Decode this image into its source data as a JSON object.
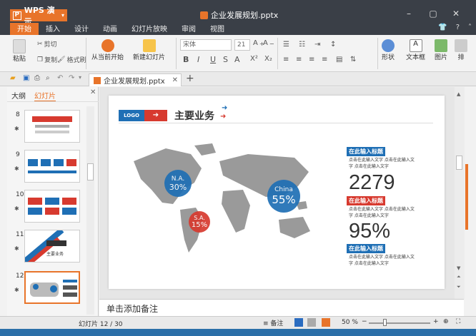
{
  "app": {
    "name": "WPS 演示",
    "doc_title": "企业发展规划.pptx"
  },
  "menus": [
    "开始",
    "插入",
    "设计",
    "动画",
    "幻灯片放映",
    "审阅",
    "视图"
  ],
  "ribbon": {
    "paste": "粘贴",
    "cut": "剪切",
    "copy": "复制",
    "format_painter": "格式刷",
    "from_current": "从当前开始",
    "new_slide": "新建幻灯片",
    "font_name": "宋体",
    "font_size": "21",
    "shape": "形状",
    "textbox": "文本框",
    "picture": "图片",
    "arrange": "排"
  },
  "doc_tab": {
    "label": "企业发展规划.pptx"
  },
  "left_panel": {
    "tabs": [
      "大纲",
      "幻灯片"
    ],
    "slides": [
      "8",
      "9",
      "10",
      "11",
      "12"
    ],
    "slide11_caption": "主要业务"
  },
  "slide": {
    "logo": "LOGO",
    "title": "主要业务",
    "na_label": "N.A.",
    "na_pct": "30%",
    "sa_label": "S.A.",
    "sa_pct": "15%",
    "china_label": "China",
    "china_pct": "55%",
    "block1_label": "在此输入标题",
    "block1_text": "点击在此输入文字  点击在此输入文字  点击在此输入文字",
    "big1": "2279",
    "block2_label": "在此输入标题",
    "block2_text": "点击在此输入文字  点击在此输入文字  点击在此输入文字",
    "big2": "95%",
    "block3_label": "在此输入标题",
    "block3_text": "点击在此输入文字  点击在此输入文字  点击在此输入文字"
  },
  "notes_placeholder": "单击添加备注",
  "status": {
    "slide_counter": "幻灯片 12 / 30",
    "notes": "备注",
    "zoom": "50 %"
  },
  "colors": {
    "accent": "#e8742a",
    "blue": "#1f6fb5",
    "red": "#d73a2f"
  }
}
